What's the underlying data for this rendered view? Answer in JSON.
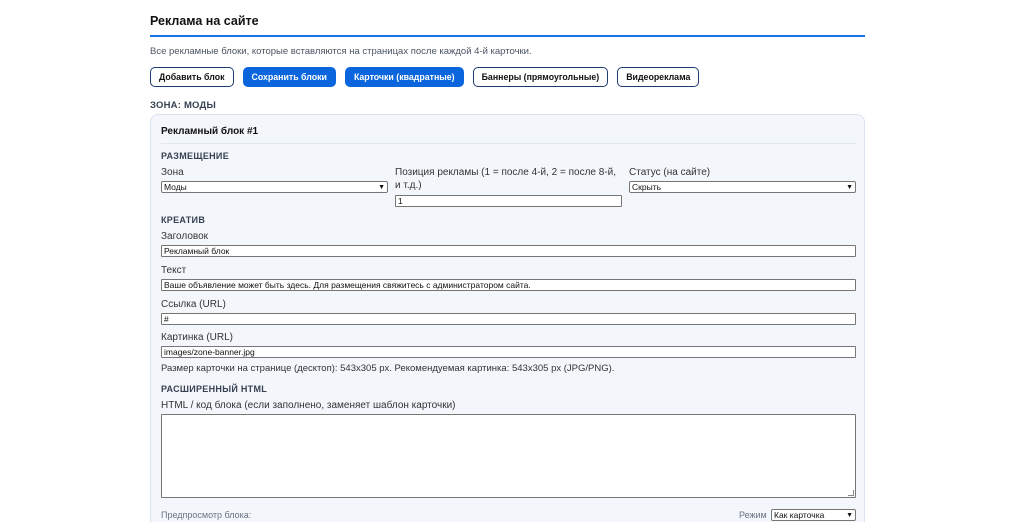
{
  "header": {
    "title": "Реклама на сайте",
    "subtitle": "Все рекламные блоки, которые вставляются на страницах после каждой 4-й карточки."
  },
  "toolbar": {
    "add_block": "Добавить блок",
    "save_blocks": "Сохранить блоки",
    "cards_square": "Карточки (квадратные)",
    "banners_rect": "Баннеры (прямоугольные)",
    "video_ads": "Видеореклама"
  },
  "zone_heading": "ЗОНА: МОДЫ",
  "block": {
    "title": "Рекламный блок #1",
    "placement": {
      "section": "РАЗМЕЩЕНИЕ",
      "zone_label": "Зона",
      "zone_value": "Моды",
      "position_label": "Позиция рекламы (1 = после 4-й, 2 = после 8-й, и т.д.)",
      "position_value": "1",
      "status_label": "Статус (на сайте)",
      "status_value": "Скрыть"
    },
    "creative": {
      "section": "КРЕАТИВ",
      "heading_label": "Заголовок",
      "heading_value": "Рекламный блок",
      "text_label": "Текст",
      "text_value": "Ваше объявление может быть здесь. Для размещения свяжитесь с администратором сайта.",
      "link_label": "Ссылка (URL)",
      "link_value": "#",
      "image_label": "Картинка (URL)",
      "image_value": "images/zone-banner.jpg",
      "image_help": "Размер карточки на странице (десктоп): 543x305 px. Рекомендуемая картинка: 543x305 px (JPG/PNG)."
    },
    "advanced": {
      "section": "РАСШИРЕННЫЙ HTML",
      "html_label": "HTML / код блока (если заполнено, заменяет шаблон карточки)",
      "html_value": ""
    },
    "preview": {
      "label": "Предпросмотр блока:",
      "mode_label": "Режим",
      "mode_value": "Как карточка"
    }
  },
  "colors": {
    "accent": "#0b66dd",
    "card_bg": "#f3f7fc"
  }
}
